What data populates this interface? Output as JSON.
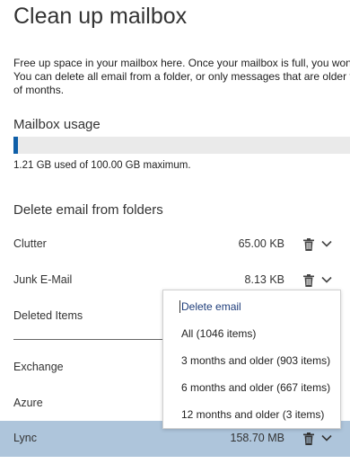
{
  "page": {
    "title": "Clean up mailbox",
    "description_lines": [
      "Free up space in your mailbox here. Once your mailbox is full, you won't",
      "You can delete all email from a folder, or only messages that are older t",
      "of months."
    ]
  },
  "usage": {
    "heading": "Mailbox usage",
    "summary": "1.21 GB used of 100.00 GB maximum.",
    "used_fraction": 0.0121,
    "fill_color": "#0f5fa8"
  },
  "folders": {
    "heading": "Delete email from folders",
    "rows": [
      {
        "name": "Clutter",
        "size": "65.00 KB"
      },
      {
        "name": "Junk E-Mail",
        "size": "8.13 KB"
      },
      {
        "name": "Deleted Items",
        "size": ""
      },
      {
        "name": "Exchange",
        "size": ""
      },
      {
        "name": "Azure",
        "size": ""
      },
      {
        "name": "Lync",
        "size": "158.70 MB",
        "selected": true
      }
    ],
    "icons": {
      "delete": "trash-icon",
      "expand": "chevron-down-icon"
    },
    "selected_color": "#aec5db"
  },
  "menu": {
    "header": "Delete email",
    "items": [
      "All (1046 items)",
      "3 months and older (903 items)",
      "6 months and older (667 items)",
      "12 months and older (3 items)"
    ]
  }
}
